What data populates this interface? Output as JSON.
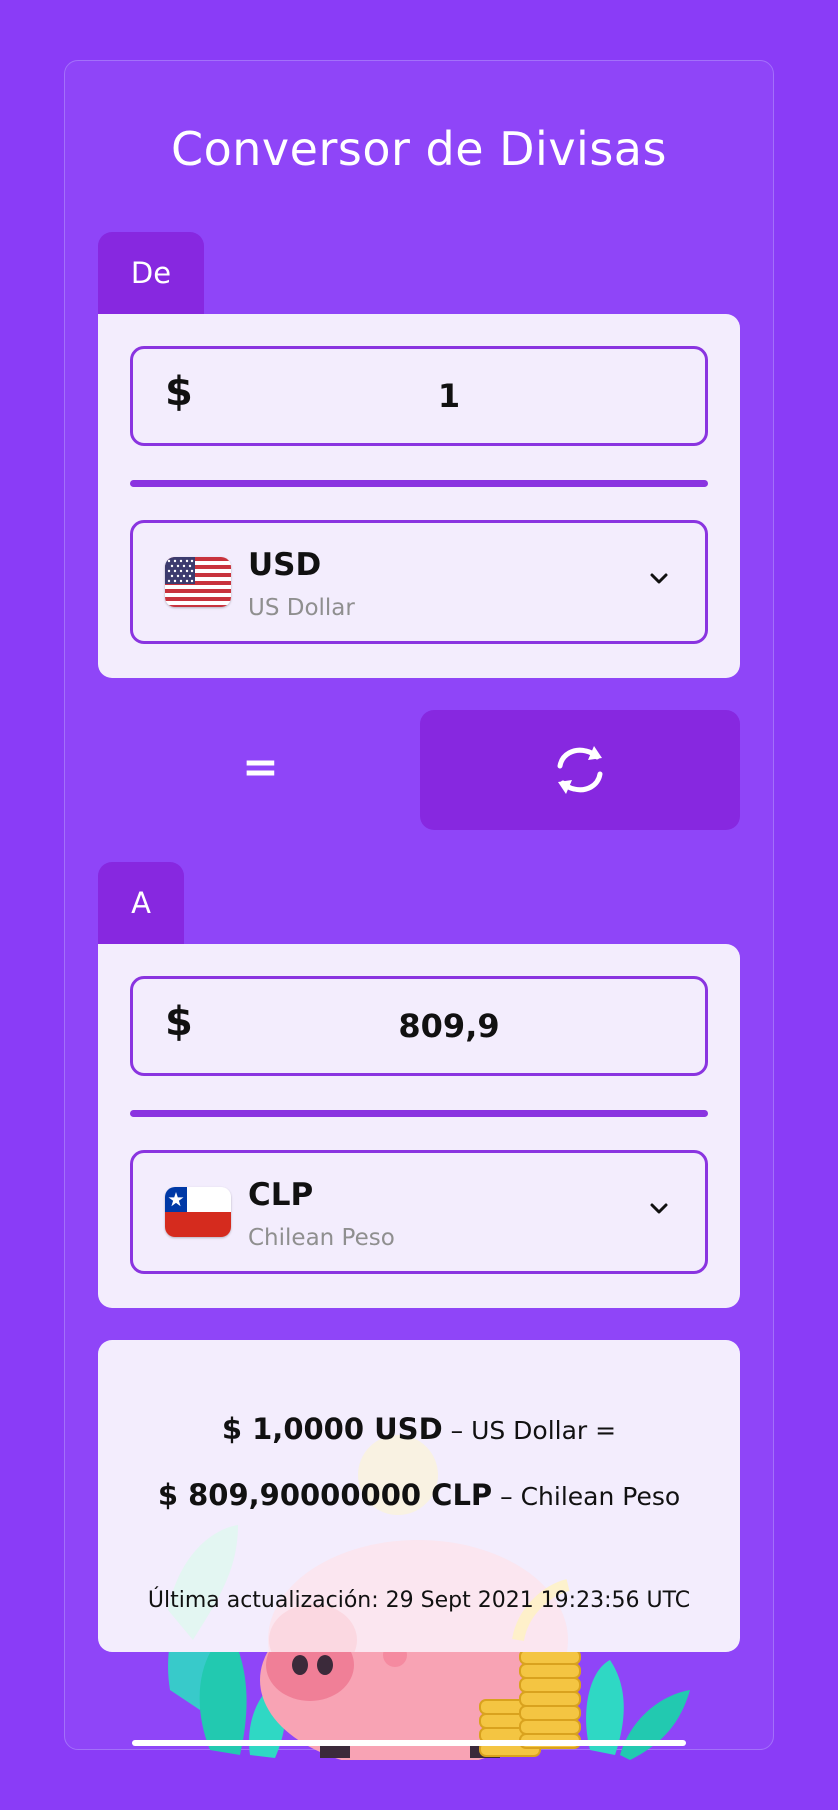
{
  "app": {
    "title": "Conversor de Divisas"
  },
  "from": {
    "tab_label": "De",
    "currency_symbol": "$",
    "amount": "1",
    "currency_code": "USD",
    "currency_name": "US Dollar",
    "flag": "us-flag-icon"
  },
  "equals_sign": "=",
  "swap_icon": "swap-arrows-icon",
  "to": {
    "tab_label": "A",
    "currency_symbol": "$",
    "amount": "809,9",
    "currency_code": "CLP",
    "currency_name": "Chilean Peso",
    "flag": "chile-flag-icon"
  },
  "result": {
    "from_amount": "$ 1,0000 USD",
    "from_name": "US Dollar",
    "equals": "=",
    "to_amount": "$ 809,90000000 CLP",
    "to_name": "Chilean Peso",
    "separator": "–",
    "last_update": "Última actualización: 29 Sept 2021 19:23:56 UTC"
  },
  "colors": {
    "background": "#8a3cf7",
    "accent": "#8728e0",
    "panel": "#f3edfd"
  }
}
